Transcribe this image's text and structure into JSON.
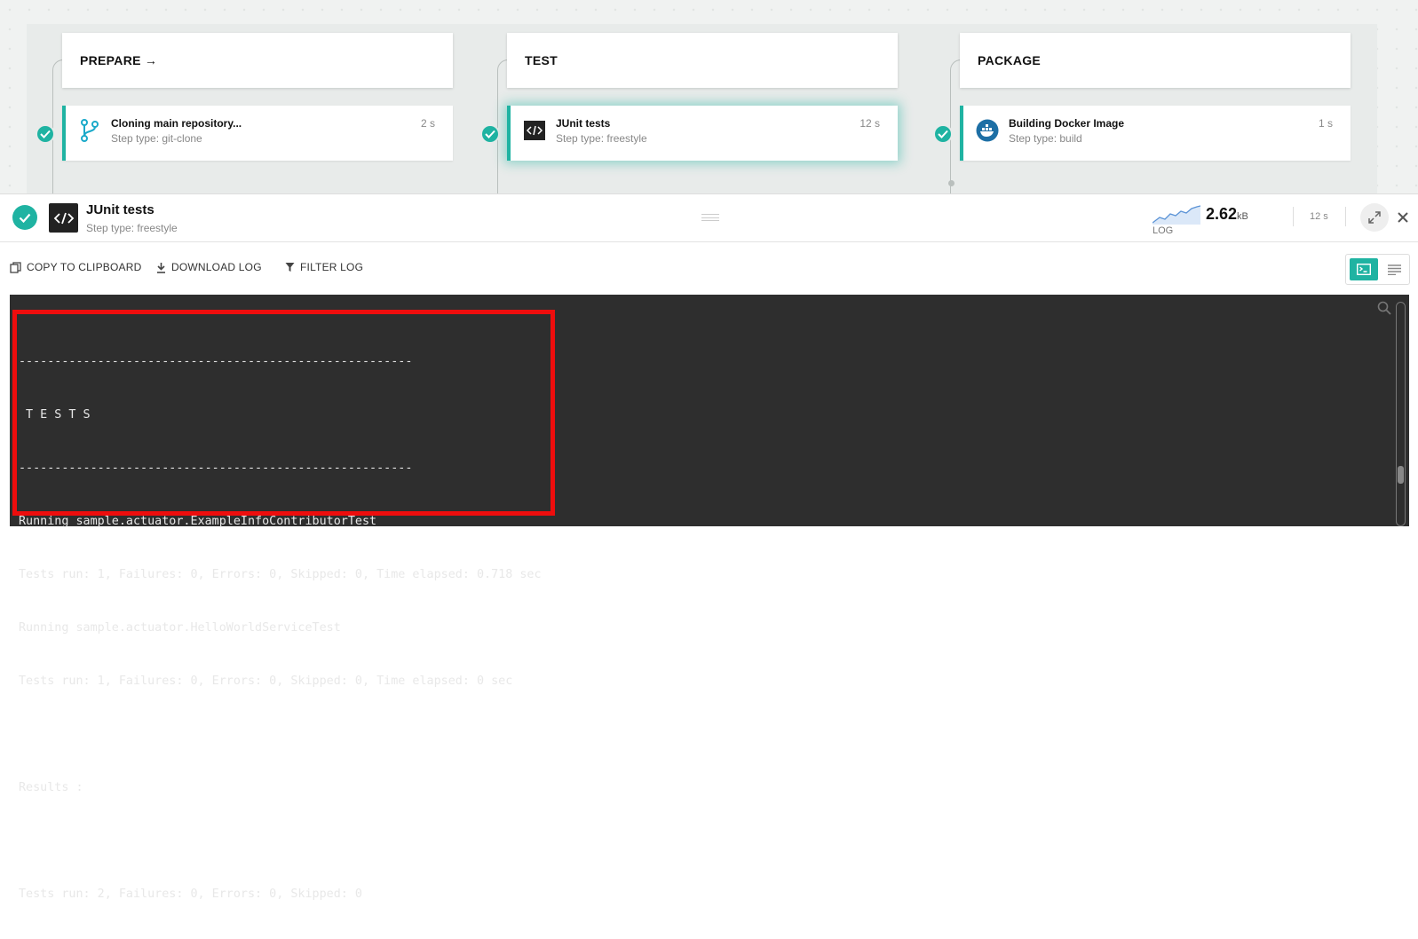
{
  "pipeline": {
    "stages": [
      {
        "title": "PREPARE →",
        "step": {
          "title": "Cloning main repository...",
          "subtitle": "Step type: git-clone",
          "time": "2 s",
          "icon": "git-branch-icon"
        }
      },
      {
        "title": "TEST",
        "step": {
          "title": "JUnit tests",
          "subtitle": "Step type: freestyle",
          "time": "12 s",
          "icon": "code-icon"
        }
      },
      {
        "title": "PACKAGE",
        "step": {
          "title": "Building Docker Image",
          "subtitle": "Step type: build",
          "time": "1 s",
          "icon": "docker-icon"
        }
      }
    ]
  },
  "detail": {
    "title": "JUnit tests",
    "subtitle": "Step type: freestyle",
    "log_size": "2.62",
    "log_unit": "kB",
    "log_label": "LOG",
    "time": "12 s"
  },
  "toolbar": {
    "copy_label": "COPY TO CLIPBOARD",
    "download_label": "DOWNLOAD LOG",
    "filter_label": "FILTER LOG"
  },
  "terminal": {
    "lines": [
      "-------------------------------------------------------",
      " T E S T S",
      "-------------------------------------------------------",
      "Running sample.actuator.ExampleInfoContributorTest",
      "Tests run: 1, Failures: 0, Errors: 0, Skipped: 0, Time elapsed: 0.718 sec",
      "Running sample.actuator.HelloWorldServiceTest",
      "Tests run: 1, Failures: 0, Errors: 0, Skipped: 0, Time elapsed: 0 sec",
      "",
      "Results :",
      "",
      "Tests run: 2, Failures: 0, Errors: 0, Skipped: 0"
    ]
  },
  "colors": {
    "accent": "#1fb3a2",
    "highlight": "#ee0d0d",
    "terminal_bg": "#2e2e2e"
  }
}
